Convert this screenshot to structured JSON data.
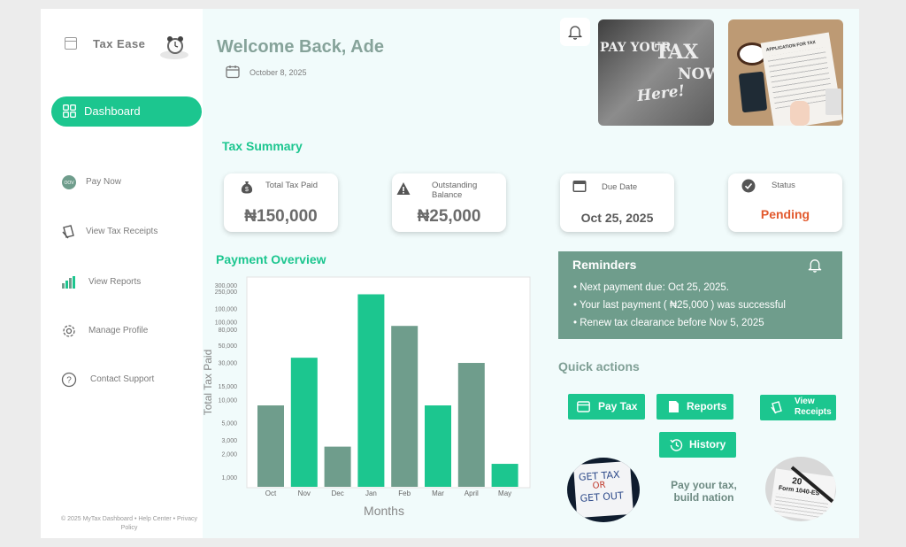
{
  "brand": {
    "name": "Tax Ease"
  },
  "nav": {
    "active": "Dashboard",
    "items": [
      "Pay Now",
      "View Tax Receipts",
      "View Reports",
      "Manage Profile",
      "Contact Support"
    ],
    "pay_now_icon_text": "OOV"
  },
  "footer": {
    "text": "© 2025 MyTax Dashboard • Help Center • Privacy Policy"
  },
  "header": {
    "welcome": "Welcome Back, Ade",
    "date": "October 8, 2025"
  },
  "photos": {
    "poster_lines": [
      "PAY YOUR",
      "TAX",
      "NOW",
      "Here!"
    ],
    "form_label": "APPLICATION FOR TAX"
  },
  "tax_summary": {
    "title": "Tax Summary",
    "cards": [
      {
        "label": "Total Tax Paid",
        "value": "₦150,000",
        "icon": "money-bag-icon"
      },
      {
        "label": "Outstanding Balance",
        "value": "₦25,000",
        "icon": "warning-icon"
      },
      {
        "label": "Due Date",
        "value": "Oct 25, 2025",
        "icon": "calendar-icon"
      },
      {
        "label": "Status",
        "value": "Pending",
        "icon": "check-badge-icon"
      }
    ],
    "status_color": "#e2592d"
  },
  "chart_title": "Payment Overview",
  "chart_data": {
    "type": "bar",
    "categories": [
      "Oct",
      "Nov",
      "Dec",
      "Jan",
      "Feb",
      "Mar",
      "April",
      "May"
    ],
    "values": [
      8500,
      35000,
      2500,
      230000,
      90000,
      8500,
      30000,
      1500
    ],
    "xlabel": "Months",
    "ylabel": "Total Tax Paid",
    "scale": "log",
    "ticks": [
      1000,
      2000,
      3000,
      5000,
      10000,
      15000,
      30000,
      50000,
      80000,
      100000,
      150000,
      250000,
      300000
    ],
    "tick_labels": [
      "1,000",
      "2,000",
      "3,000",
      "5,000",
      "10,000",
      "15,000",
      "30,000",
      "50,000",
      "80,000",
      "100,000",
      "100,000",
      "250,000",
      "300,000"
    ],
    "colors": [
      "#6f9d8c",
      "#1cc68f",
      "#6f9d8c",
      "#1cc68f",
      "#6f9d8c",
      "#1cc68f",
      "#6f9d8c",
      "#1cc68f"
    ],
    "grid": false
  },
  "reminders": {
    "title": "Reminders",
    "items": [
      "Next payment due: Oct 25, 2025.",
      "Your last payment ( ₦25,000 ) was successful",
      "Renew tax clearance before Nov 5, 2025"
    ]
  },
  "quick_actions": {
    "title": "Quick actions",
    "pay_tax": "Pay Tax",
    "reports": "Reports",
    "view_receipts_1": "View",
    "view_receipts_2": "Receipts",
    "history": "History"
  },
  "circles": {
    "note_lines": [
      "GET TAX",
      "OR",
      "GET OUT"
    ],
    "form_num": "20",
    "form_name": "Form 1040-ES"
  },
  "tagline": "Pay your tax, build nation",
  "colors": {
    "accent": "#1cc68f",
    "muted": "#6f9d8c",
    "bg": "#f1fbfb"
  }
}
